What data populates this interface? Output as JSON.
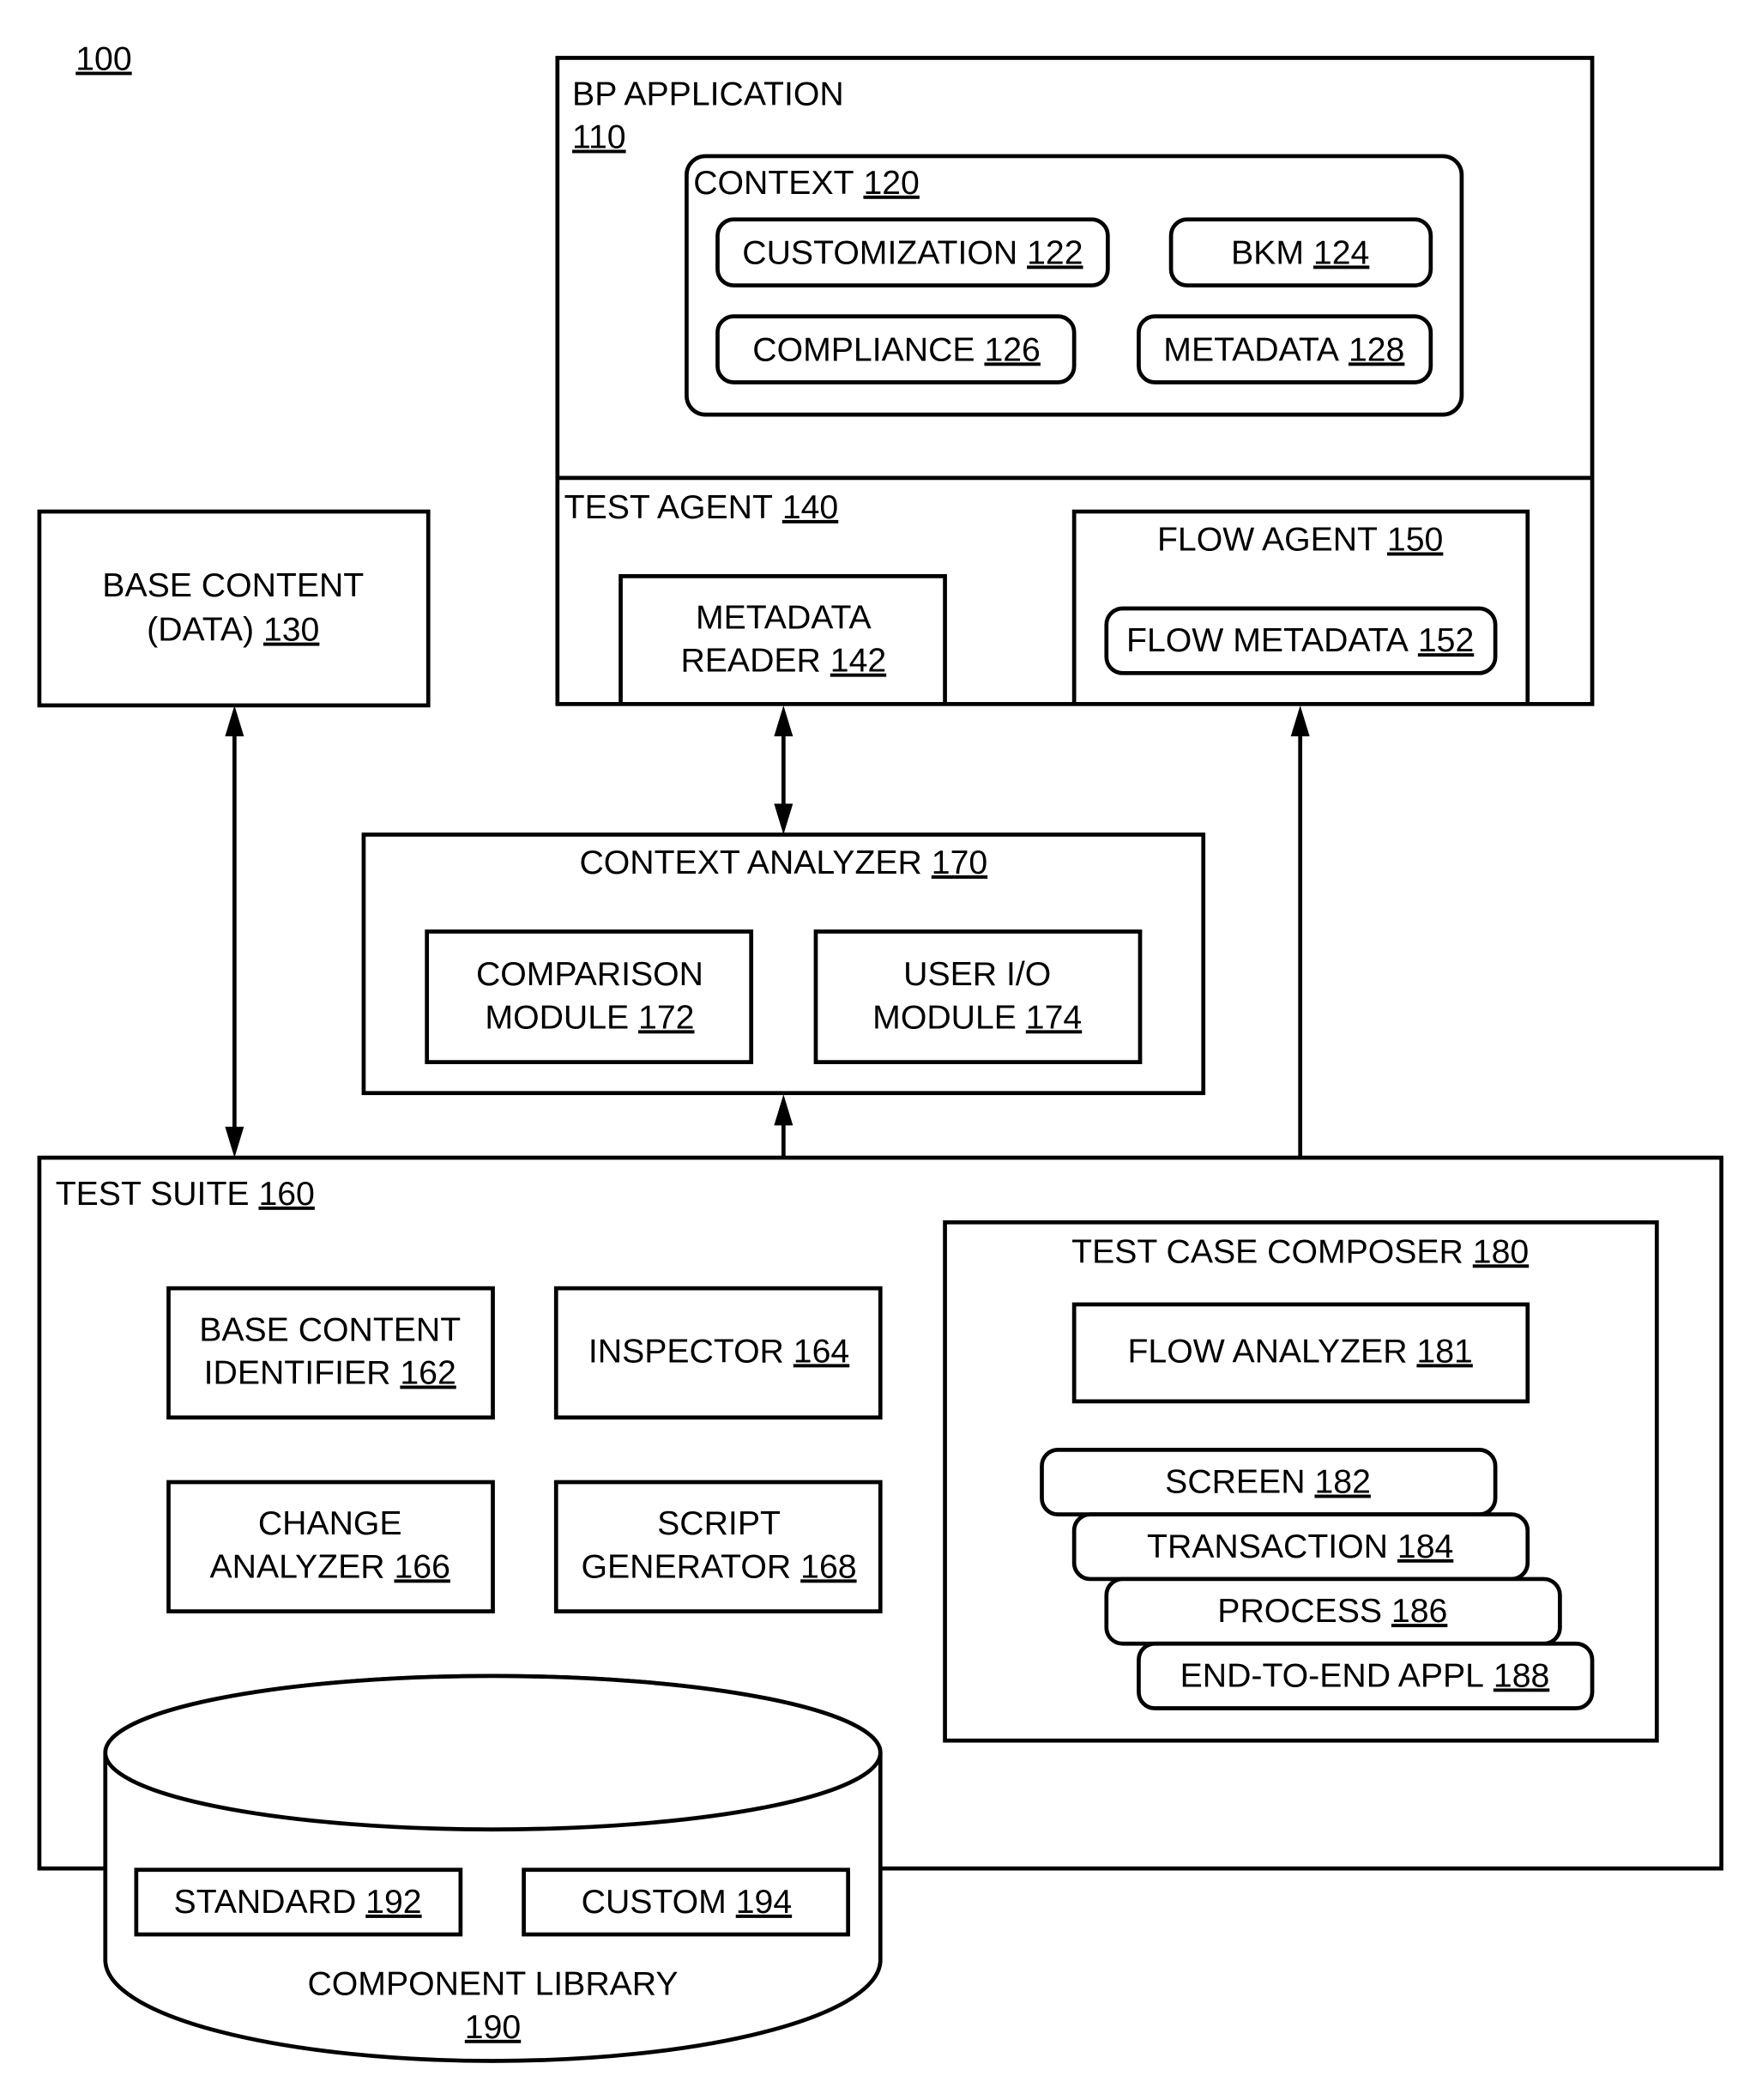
{
  "figure_ref": "100",
  "bp_application": {
    "label": "BP APPLICATION",
    "ref": "110",
    "context": {
      "label": "CONTEXT",
      "ref": "120",
      "items": [
        {
          "label": "CUSTOMIZATION",
          "ref": "122"
        },
        {
          "label": "BKM",
          "ref": "124"
        },
        {
          "label": "COMPLIANCE",
          "ref": "126"
        },
        {
          "label": "METADATA",
          "ref": "128"
        }
      ]
    },
    "test_agent": {
      "label": "TEST AGENT",
      "ref": "140",
      "metadata_reader": {
        "line1": "METADATA",
        "line2": "READER",
        "ref": "142"
      },
      "flow_agent": {
        "label": "FLOW AGENT",
        "ref": "150",
        "flow_metadata": {
          "label": "FLOW METADATA",
          "ref": "152"
        }
      }
    }
  },
  "base_content": {
    "line1": "BASE CONTENT",
    "line2": "(DATA)",
    "ref": "130"
  },
  "context_analyzer": {
    "label": "CONTEXT ANALYZER",
    "ref": "170",
    "comparison_module": {
      "line1": "COMPARISON",
      "line2": "MODULE",
      "ref": "172"
    },
    "user_io_module": {
      "line1": "USER I/O",
      "line2": "MODULE",
      "ref": "174"
    }
  },
  "test_suite": {
    "label": "TEST SUITE",
    "ref": "160",
    "base_content_identifier": {
      "line1": "BASE CONTENT",
      "line2": "IDENTIFIER",
      "ref": "162"
    },
    "inspector": {
      "label": "INSPECTOR",
      "ref": "164"
    },
    "change_analyzer": {
      "line1": "CHANGE",
      "line2": "ANALYZER",
      "ref": "166"
    },
    "script_generator": {
      "line1": "SCRIPT",
      "line2": "GENERATOR",
      "ref": "168"
    },
    "test_case_composer": {
      "label": "TEST CASE COMPOSER",
      "ref": "180",
      "flow_analyzer": {
        "label": "FLOW ANALYZER",
        "ref": "181"
      },
      "levels": [
        {
          "label": "SCREEN",
          "ref": "182"
        },
        {
          "label": "TRANSACTION",
          "ref": "184"
        },
        {
          "label": "PROCESS",
          "ref": "186"
        },
        {
          "label": "END-TO-END APPL",
          "ref": "188"
        }
      ]
    }
  },
  "component_library": {
    "label": "COMPONENT LIBRARY",
    "ref": "190",
    "standard": {
      "label": "STANDARD",
      "ref": "192"
    },
    "custom": {
      "label": "CUSTOM",
      "ref": "194"
    }
  }
}
